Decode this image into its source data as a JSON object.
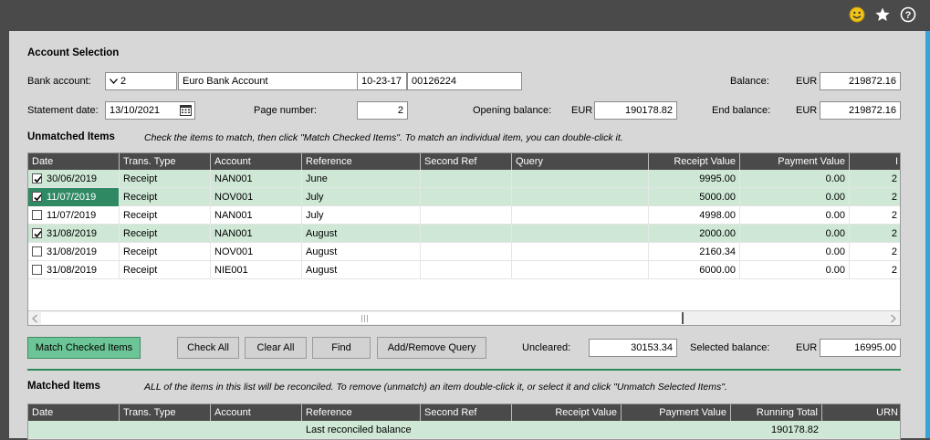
{
  "topbar": {
    "icons": [
      "smiley-icon",
      "star-icon",
      "help-icon"
    ]
  },
  "selection": {
    "title": "Account Selection",
    "bank_account_label": "Bank account:",
    "bank_code": "2",
    "bank_name": "Euro Bank Account",
    "sort_code": "10-23-17",
    "account_number": "00126224",
    "balance_label": "Balance:",
    "balance_currency": "EUR",
    "balance_value": "219872.16",
    "statement_date_label": "Statement date:",
    "statement_date": "13/10/2021",
    "page_number_label": "Page number:",
    "page_number": "2",
    "opening_balance_label": "Opening balance:",
    "opening_currency": "EUR",
    "opening_value": "190178.82",
    "end_balance_label": "End balance:",
    "end_currency": "EUR",
    "end_value": "219872.16"
  },
  "unmatched": {
    "title": "Unmatched Items",
    "hint": "Check the items to match, then click \"Match Checked Items\". To match an individual item, you can double-click it.",
    "columns": [
      "Date",
      "Trans. Type",
      "Account",
      "Reference",
      "Second Ref",
      "Query",
      "Receipt Value",
      "Payment Value",
      "I"
    ],
    "rows": [
      {
        "checked": true,
        "selected": true,
        "highlight": false,
        "cells": [
          "30/06/2019",
          "Receipt",
          "NAN001",
          "June",
          "",
          "",
          "9995.00",
          "0.00",
          "2"
        ]
      },
      {
        "checked": true,
        "selected": true,
        "highlight": true,
        "cells": [
          "11/07/2019",
          "Receipt",
          "NOV001",
          "July",
          "",
          "",
          "5000.00",
          "0.00",
          "2"
        ]
      },
      {
        "checked": false,
        "selected": false,
        "highlight": false,
        "cells": [
          "11/07/2019",
          "Receipt",
          "NAN001",
          "July",
          "",
          "",
          "4998.00",
          "0.00",
          "2"
        ]
      },
      {
        "checked": true,
        "selected": true,
        "highlight": false,
        "cells": [
          "31/08/2019",
          "Receipt",
          "NAN001",
          "August",
          "",
          "",
          "2000.00",
          "0.00",
          "2"
        ]
      },
      {
        "checked": false,
        "selected": false,
        "highlight": false,
        "cells": [
          "31/08/2019",
          "Receipt",
          "NOV001",
          "August",
          "",
          "",
          "2160.34",
          "0.00",
          "2"
        ]
      },
      {
        "checked": false,
        "selected": false,
        "highlight": false,
        "cells": [
          "31/08/2019",
          "Receipt",
          "NIE001",
          "August",
          "",
          "",
          "6000.00",
          "0.00",
          "2"
        ]
      }
    ]
  },
  "actions": {
    "match_checked": "Match Checked Items",
    "check_all": "Check All",
    "clear_all": "Clear All",
    "find": "Find",
    "add_remove_query": "Add/Remove Query",
    "uncleared_label": "Uncleared:",
    "uncleared_value": "30153.34",
    "selected_balance_label": "Selected balance:",
    "selected_currency": "EUR",
    "selected_value": "16995.00"
  },
  "matched": {
    "title": "Matched Items",
    "hint": "ALL of the items in this list will be reconciled. To remove (unmatch) an item double-click it, or select it and click \"Unmatch Selected Items\".",
    "columns": [
      "Date",
      "Trans. Type",
      "Account",
      "Reference",
      "Second Ref",
      "Receipt Value",
      "Payment Value",
      "Running Total",
      "URN"
    ],
    "rows": [
      {
        "cells": [
          "",
          "",
          "",
          "Last reconciled balance",
          "",
          "",
          "",
          "190178.82",
          ""
        ]
      }
    ]
  },
  "colors": {
    "accent": "#6cc596",
    "selected_row": "#cfe8d5",
    "highlight": "#2f8a64",
    "header": "#4a4a4a"
  }
}
